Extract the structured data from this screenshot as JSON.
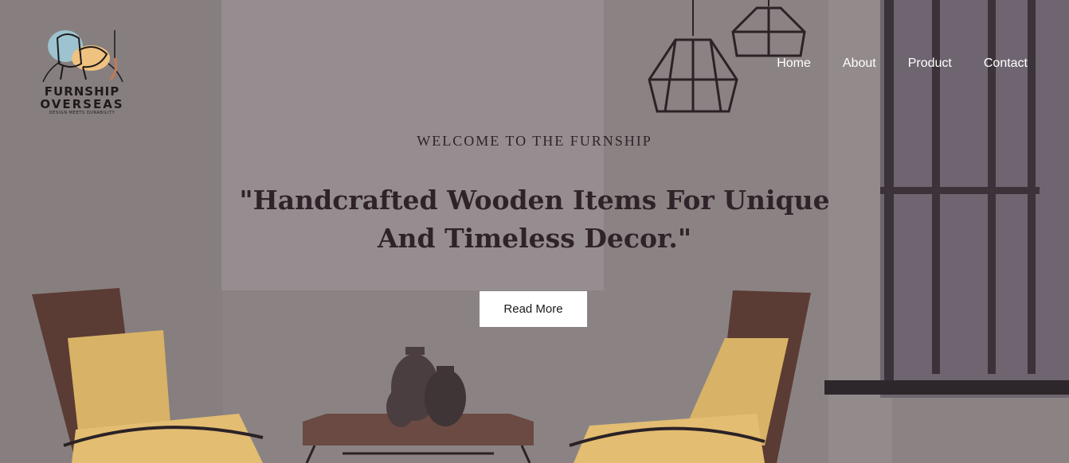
{
  "brand": {
    "line1": "FURNSHIP",
    "line2": "OVERSEAS",
    "tagline": "DESIGN MEETS DURABILITY"
  },
  "nav": {
    "items": [
      {
        "label": "Home"
      },
      {
        "label": "About"
      },
      {
        "label": "Product"
      },
      {
        "label": "Contact"
      }
    ]
  },
  "hero": {
    "eyebrow": "WELCOME TO THE FURNSHIP",
    "headline": "\"Handcrafted Wooden Items For Unique And Timeless Decor.\"",
    "cta_label": "Read More"
  },
  "colors": {
    "text_dark": "#2f2329",
    "nav_text": "#ffffff",
    "button_bg": "#ffffff"
  }
}
